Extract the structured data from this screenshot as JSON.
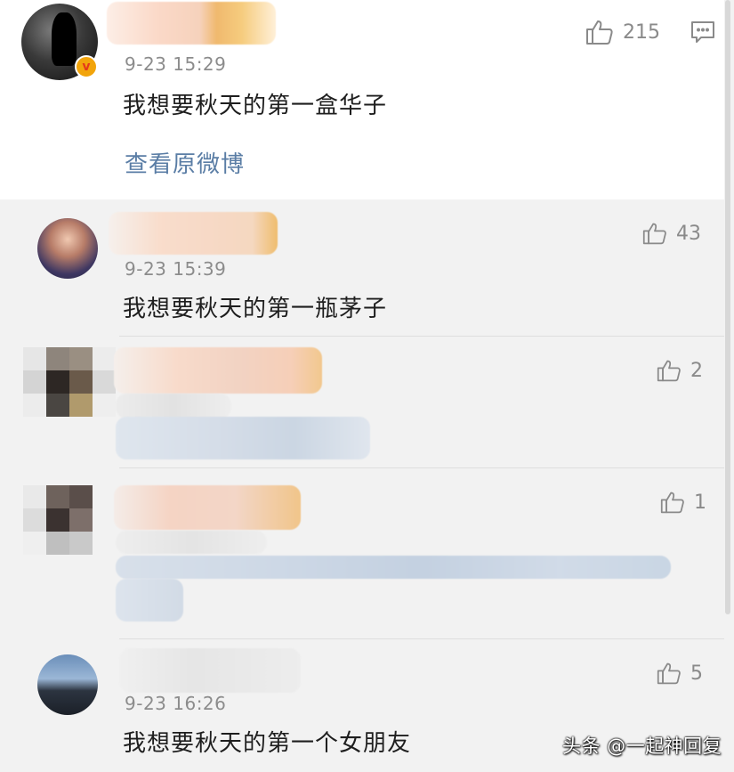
{
  "main_post": {
    "time": "9-23 15:29",
    "text": "我想要秋天的第一盒华子",
    "like_count": "215",
    "view_original_label": "查看原微博",
    "verified_badge": "v"
  },
  "comments": [
    {
      "time": "9-23 15:39",
      "text": "我想要秋天的第一瓶茅子",
      "like_count": "43"
    },
    {
      "like_count": "2"
    },
    {
      "like_count": "1"
    },
    {
      "time": "9-23 16:26",
      "text": "我想要秋天的第一个女朋友",
      "like_count": "5"
    }
  ],
  "watermark": "头条 @一起神回复",
  "colors": {
    "link": "#5a7da5",
    "timestamp": "#8c8c8c",
    "like_icon": "#8a8a8a",
    "verified_badge": "#f2a40b"
  },
  "icons": {
    "like": "thumbs-up-outline",
    "comment": "speech-bubble-outline"
  }
}
